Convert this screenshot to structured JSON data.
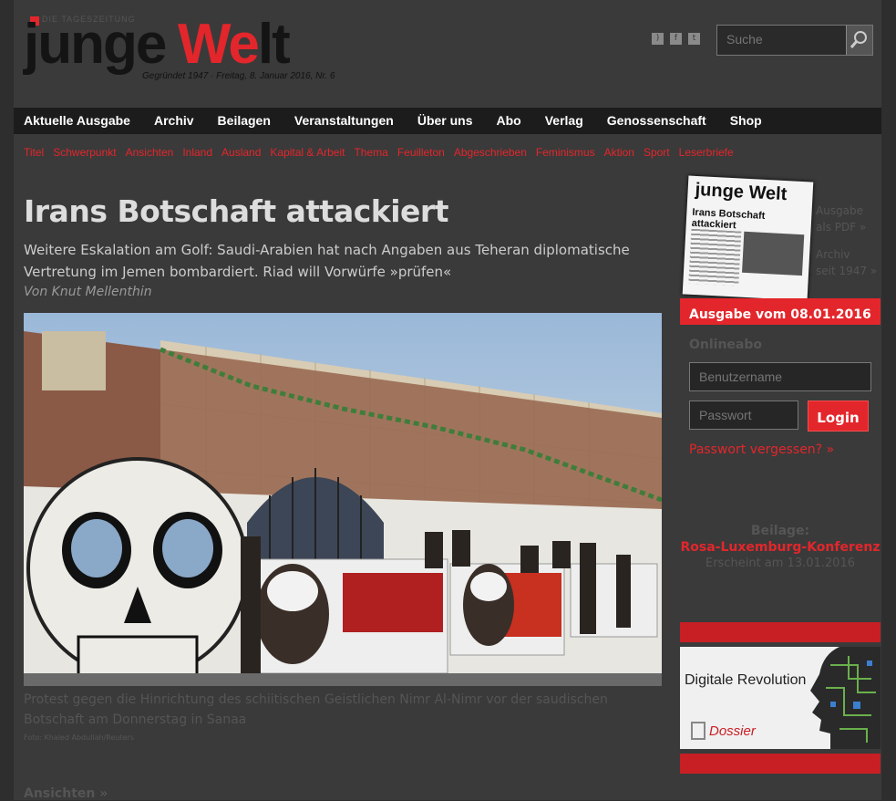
{
  "header": {
    "tagline": "DIE TAGESZEITUNG",
    "logo_junge": "junge",
    "logo_we": "We",
    "logo_lt": "lt",
    "subline": "Gegründet 1947 · Freitag, 8. Januar 2016, Nr. 6",
    "search_placeholder": "Suche"
  },
  "nav": {
    "items": [
      "Aktuelle Ausgabe",
      "Archiv",
      "Beilagen",
      "Veranstaltungen",
      "Über uns",
      "Abo",
      "Verlag",
      "Genossenschaft",
      "Shop"
    ]
  },
  "subnav": {
    "items": [
      "Titel",
      "Schwerpunkt",
      "Ansichten",
      "Inland",
      "Ausland",
      "Kapital & Arbeit",
      "Thema",
      "Feuilleton",
      "Abgeschrieben",
      "Feminismus",
      "Aktion",
      "Sport",
      "Leserbriefe"
    ]
  },
  "article": {
    "title": "Irans Botschaft attackiert",
    "lead": "Weitere Eskalation am Golf: Saudi-Arabien hat nach Angaben aus Teheran diplomatische Vertretung im Jemen bombardiert. Riad will Vorwürfe »prüfen«",
    "author": "Von Knut Mellenthin",
    "caption": "Protest gegen die Hinrichtung des schiitischen Geistlichen Nimr Al-Nimr vor der saudischen Botschaft am Donnerstag in Sanaa",
    "credit": "Foto: Khaled Abdullah/Reuters",
    "section_link": "Ansichten »"
  },
  "sidebar": {
    "paper_logo": "junge Welt",
    "paper_headline": "Irans Botschaft attackiert",
    "link1_line1": "Ausgabe",
    "link1_line2": "als PDF »",
    "link2_line1": "Archiv",
    "link2_line2": "seit 1947 »",
    "ausgabe_label": "Ausgabe vom 08.01.2016",
    "onlineabo": "Onlineabo",
    "username_placeholder": "Benutzername",
    "password_placeholder": "Passwort",
    "login_label": "Login",
    "forgot_label": "Passwort vergessen? »",
    "beilage_heading": "Beilage:",
    "beilage_link": "Rosa-Luxemburg-Konferenz",
    "beilage_date": "Erscheint am 13.01.2016",
    "dossier_title": "Digitale Revolution",
    "dossier_sub": "Dossier"
  },
  "colors": {
    "accent": "#e3262b",
    "background": "#3a3a3a",
    "nav_bg": "#1c1c1c"
  }
}
